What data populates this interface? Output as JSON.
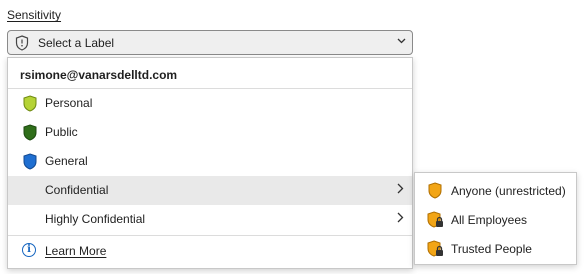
{
  "field": {
    "label": "Sensitivity"
  },
  "combo": {
    "value": "Select a Label",
    "icon": "shield-outline-icon"
  },
  "menu": {
    "account": "rsimone@vanarsdelltd.com",
    "items": [
      {
        "label": "Personal",
        "icon": "shield-icon",
        "color": "#b5d336"
      },
      {
        "label": "Public",
        "icon": "shield-icon",
        "color": "#2f6e1a"
      },
      {
        "label": "General",
        "icon": "shield-icon",
        "color": "#1f6fd1"
      },
      {
        "label": "Confidential",
        "icon": "",
        "has_submenu": true
      },
      {
        "label": "Highly Confidential",
        "icon": "",
        "has_submenu": true
      }
    ],
    "learn_more": "Learn More"
  },
  "submenu": {
    "items": [
      {
        "label": "Anyone (unrestricted)",
        "icon": "shield-icon",
        "color": "#f2a516"
      },
      {
        "label": "All Employees",
        "icon": "shield-lock-icon",
        "color": "#f2a516"
      },
      {
        "label": "Trusted People",
        "icon": "shield-lock-icon",
        "color": "#f2a516"
      }
    ]
  }
}
